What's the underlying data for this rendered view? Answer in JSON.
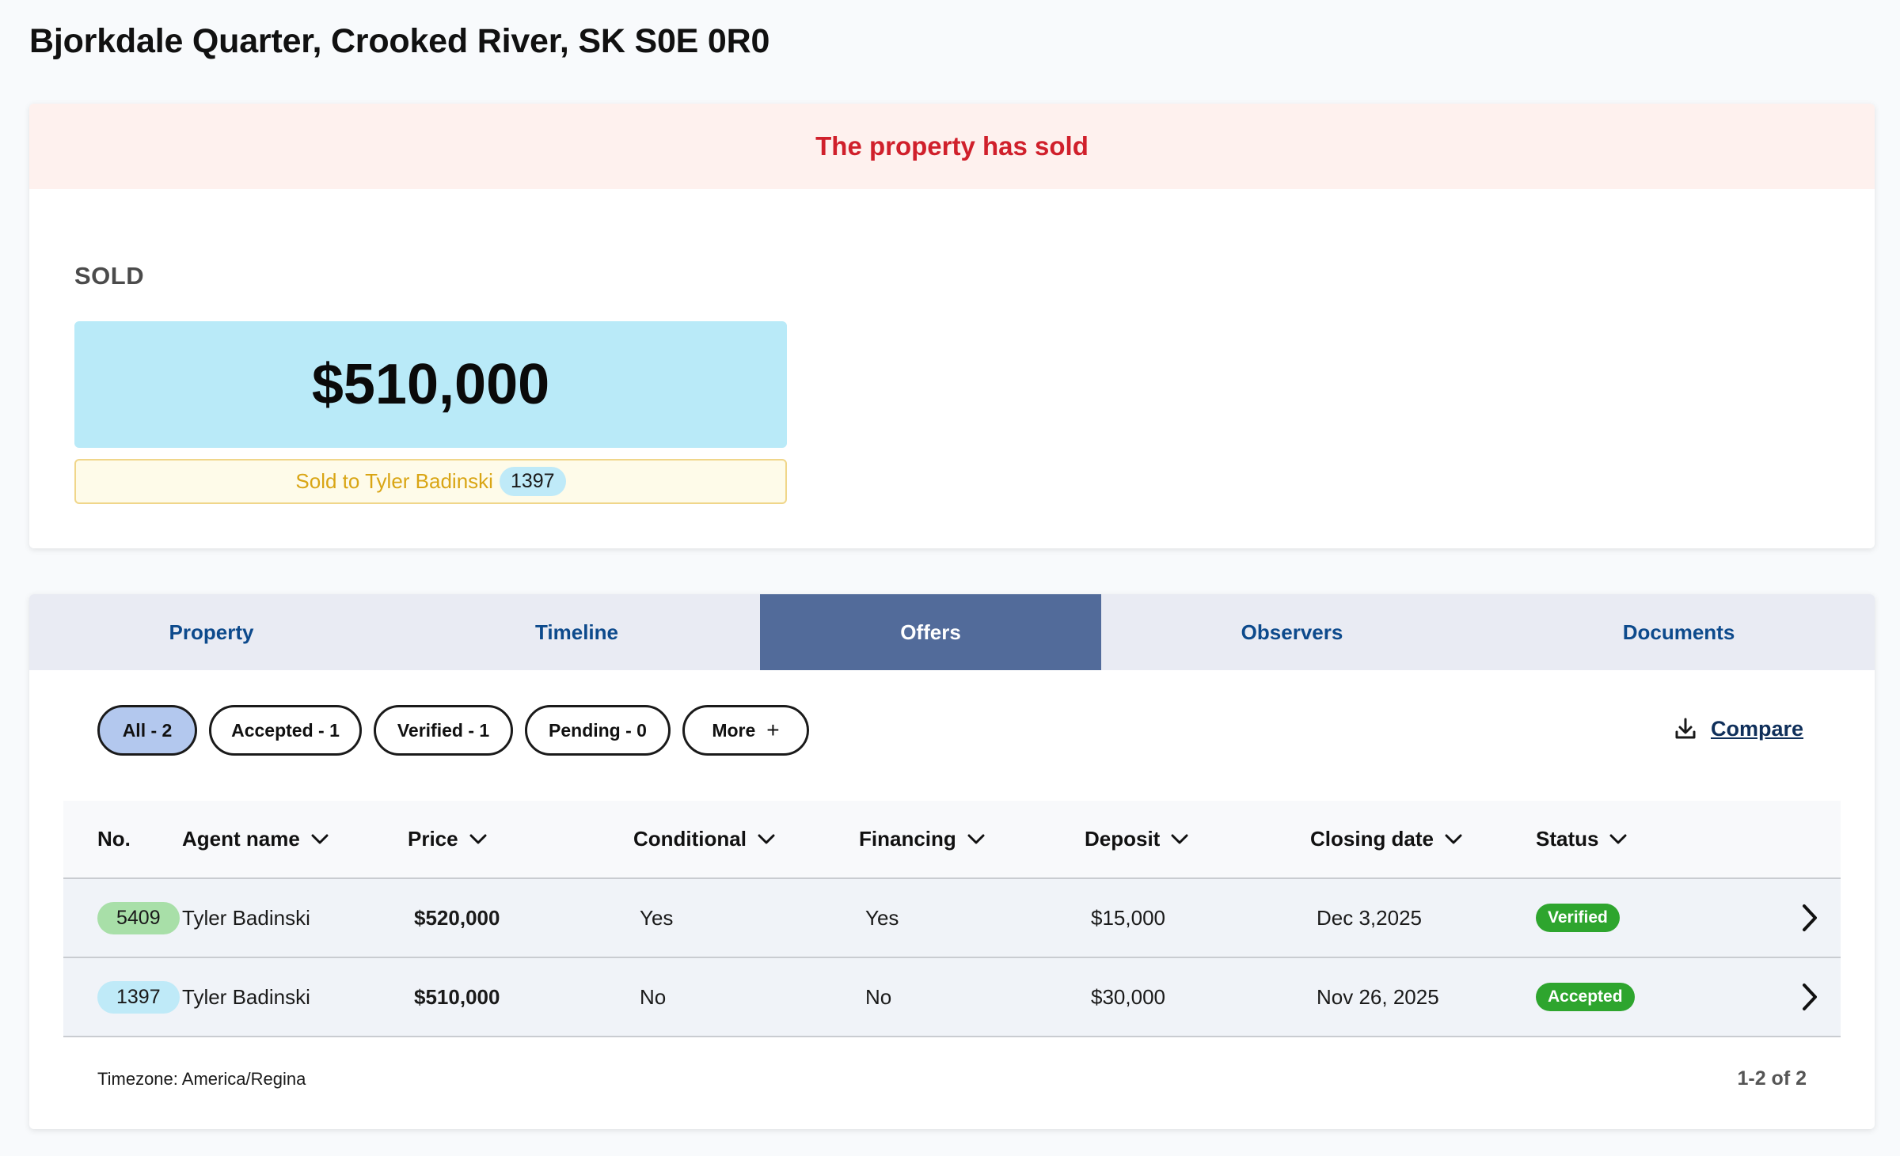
{
  "header": {
    "title": "Bjorkdale Quarter, Crooked River, SK S0E 0R0"
  },
  "sale": {
    "banner": "The property has sold",
    "status_label": "SOLD",
    "price": "$510,000",
    "sold_to_text": "Sold to Tyler Badinski",
    "buyer_id": "1397",
    "colors": {
      "banner_bg": "#fef1ee",
      "banner_text": "#d0202b",
      "price_bg": "#b9eaf8",
      "sold_to_bg": "#fefbe9",
      "sold_to_text": "#d9a514"
    }
  },
  "tabs": [
    {
      "label": "Property",
      "active": false
    },
    {
      "label": "Timeline",
      "active": false
    },
    {
      "label": "Offers",
      "active": true
    },
    {
      "label": "Observers",
      "active": false
    },
    {
      "label": "Documents",
      "active": false
    }
  ],
  "filters": [
    {
      "label": "All - 2",
      "active": true
    },
    {
      "label": "Accepted - 1",
      "active": false
    },
    {
      "label": "Verified - 1",
      "active": false
    },
    {
      "label": "Pending - 0",
      "active": false
    },
    {
      "label": "More",
      "icon": "plus-icon",
      "active": false
    }
  ],
  "compare": {
    "label": "Compare",
    "icon": "download-icon"
  },
  "table": {
    "columns": [
      "No.",
      "Agent name",
      "Price",
      "Conditional",
      "Financing",
      "Deposit",
      "Closing date",
      "Status"
    ],
    "rows": [
      {
        "no": "5409",
        "no_color": "#a8dfa8",
        "agent": "Tyler Badinski",
        "price": "$520,000",
        "conditional": "Yes",
        "financing": "Yes",
        "deposit": "$15,000",
        "closing": "Dec 3,2025",
        "status": "Verified"
      },
      {
        "no": "1397",
        "no_color": "#bfeaf8",
        "agent": "Tyler Badinski",
        "price": "$510,000",
        "conditional": "No",
        "financing": "No",
        "deposit": "$30,000",
        "closing": "Nov 26, 2025",
        "status": "Accepted"
      }
    ]
  },
  "footer": {
    "timezone": "Timezone: America/Regina",
    "range": "1-2 of 2"
  }
}
